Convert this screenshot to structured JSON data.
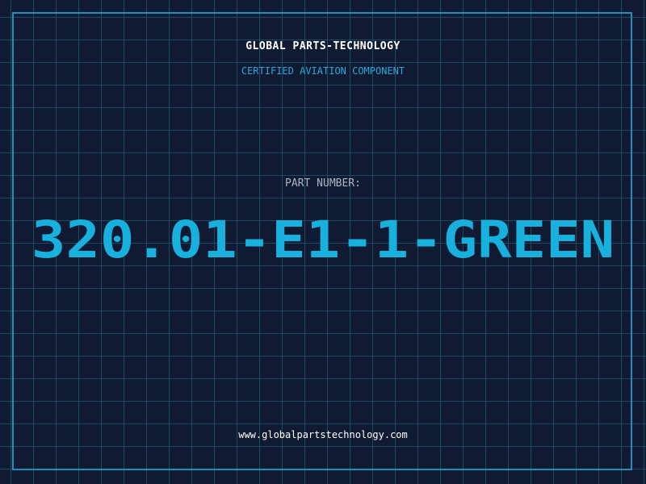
{
  "header": {
    "brand": "GLOBAL PARTS-TECHNOLOGY",
    "tagline": "CERTIFIED AVIATION COMPONENT"
  },
  "part": {
    "label": "PART NUMBER:",
    "value": "320.01-E1-1-GREEN"
  },
  "footer": {
    "website": "www.globalpartstechnology.com"
  },
  "colors": {
    "background": "#101a32",
    "grid": "#1c4a62",
    "frame": "#1d91b8",
    "accent": "#18b0dc"
  }
}
